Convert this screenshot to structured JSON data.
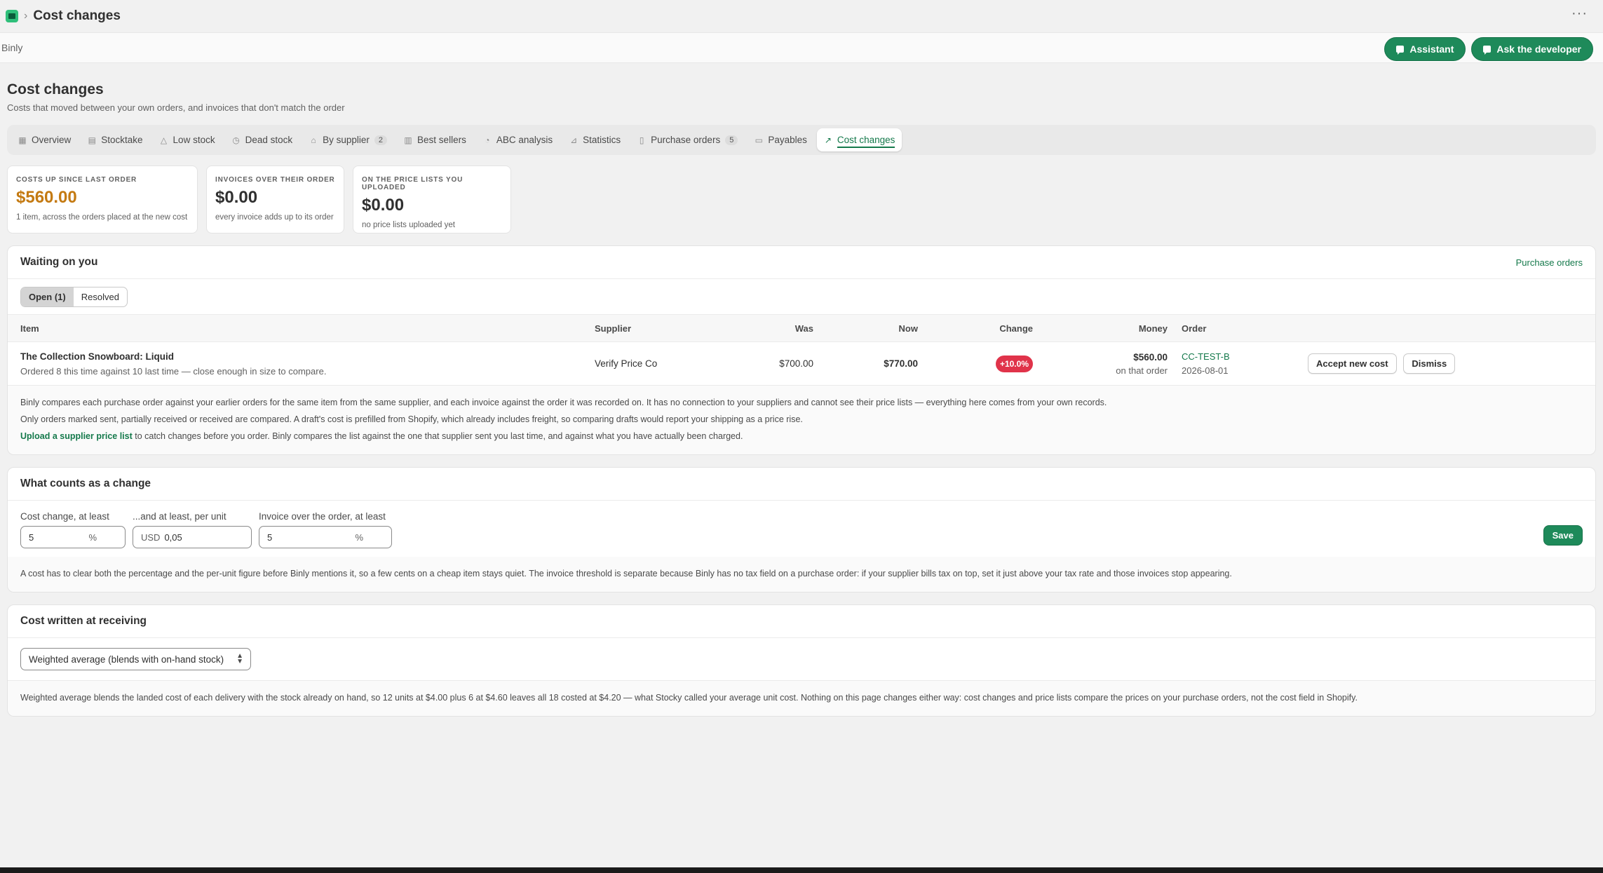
{
  "topbar": {
    "title": "Cost changes"
  },
  "appbar": {
    "name": "Binly",
    "assistant_label": "Assistant",
    "ask_dev_label": "Ask the developer"
  },
  "page": {
    "title": "Cost changes",
    "subtitle": "Costs that moved between your own orders, and invoices that don't match the order"
  },
  "tabs": [
    {
      "label": "Overview",
      "icon": "grid-icon"
    },
    {
      "label": "Stocktake",
      "icon": "clipboard-icon"
    },
    {
      "label": "Low stock",
      "icon": "warning-icon"
    },
    {
      "label": "Dead stock",
      "icon": "clock-icon"
    },
    {
      "label": "By supplier",
      "icon": "store-icon",
      "badge": "2"
    },
    {
      "label": "Best sellers",
      "icon": "bar-chart-icon"
    },
    {
      "label": "ABC analysis",
      "icon": "pie-icon"
    },
    {
      "label": "Statistics",
      "icon": "chart-icon"
    },
    {
      "label": "Purchase orders",
      "icon": "document-icon",
      "badge": "5"
    },
    {
      "label": "Payables",
      "icon": "card-icon"
    },
    {
      "label": "Cost changes",
      "icon": "trend-icon",
      "active": true
    }
  ],
  "stats": [
    {
      "label": "COSTS UP SINCE LAST ORDER",
      "value": "$560.00",
      "note": "1 item, across the orders placed at the new cost",
      "color": "#c47a12"
    },
    {
      "label": "INVOICES OVER THEIR ORDER",
      "value": "$0.00",
      "note": "every invoice adds up to its order"
    },
    {
      "label": "ON THE PRICE LISTS YOU UPLOADED",
      "value": "$0.00",
      "note": "no price lists uploaded yet"
    }
  ],
  "waiting": {
    "title": "Waiting on you",
    "link": "Purchase orders",
    "seg_open": "Open (1)",
    "seg_resolved": "Resolved",
    "columns": [
      "Item",
      "Supplier",
      "Was",
      "Now",
      "Change",
      "Money",
      "Order"
    ],
    "rows": [
      {
        "item": "The Collection Snowboard: Liquid",
        "item_sub": "Ordered 8 this time against 10 last time — close enough in size to compare.",
        "supplier": "Verify Price Co",
        "was": "$700.00",
        "now": "$770.00",
        "change": "+10.0%",
        "money": "$560.00",
        "money_sub": "on that order",
        "order": "CC-TEST-B",
        "order_date": "2026-08-01",
        "accept": "Accept new cost",
        "dismiss": "Dismiss"
      }
    ],
    "note1": "Binly compares each purchase order against your earlier orders for the same item from the same supplier, and each invoice against the order it was recorded on. It has no connection to your suppliers and cannot see their price lists — everything here comes from your own records.",
    "note2": "Only orders marked sent, partially received or received are compared. A draft's cost is prefilled from Shopify, which already includes freight, so comparing drafts would report your shipping as a price rise.",
    "note3_link": "Upload a supplier price list",
    "note3_rest": " to catch changes before you order. Binly compares the list against the one that supplier sent you last time, and against what you have actually been charged."
  },
  "counts": {
    "title": "What counts as a change",
    "f1_label": "Cost change, at least",
    "f1_value": "5",
    "f1_suffix": "%",
    "f2_label": "...and at least, per unit",
    "f2_prefix": "USD",
    "f2_value": "0,05",
    "f3_label": "Invoice over the order, at least",
    "f3_value": "5",
    "f3_suffix": "%",
    "save": "Save",
    "note": "A cost has to clear both the percentage and the per-unit figure before Binly mentions it, so a few cents on a cheap item stays quiet. The invoice threshold is separate because Binly has no tax field on a purchase order: if your supplier bills tax on top, set it just above your tax rate and those invoices stop appearing."
  },
  "receiving": {
    "title": "Cost written at receiving",
    "select_value": "Weighted average (blends with on-hand stock)",
    "note": "Weighted average blends the landed cost of each delivery with the stock already on hand, so 12 units at $4.00 plus 6 at $4.60 leaves all 18 costed at $4.20 — what Stocky called your average unit cost. Nothing on this page changes either way: cost changes and price lists compare the prices on your purchase orders, not the cost field in Shopify."
  },
  "colors": {
    "accent": "#14794b",
    "badge_red": "#e0334a",
    "orange": "#c47a12"
  }
}
